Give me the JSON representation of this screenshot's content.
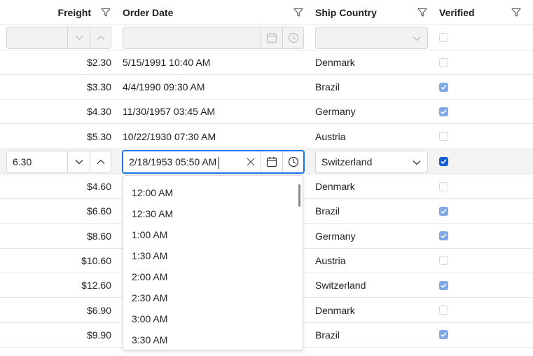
{
  "header": {
    "freight": "Freight",
    "order_date": "Order Date",
    "ship_country": "Ship Country",
    "verified": "Verified"
  },
  "filter_row": {
    "freight_value": "",
    "date_value": "",
    "country_value": ""
  },
  "rows_top": [
    {
      "freight": "$2.30",
      "date": "5/15/1991 10:40 AM",
      "country": "Denmark",
      "verified": false
    },
    {
      "freight": "$3.30",
      "date": "4/4/1990 09:30 AM",
      "country": "Brazil",
      "verified": true
    },
    {
      "freight": "$4.30",
      "date": "11/30/1957 03:45 AM",
      "country": "Germany",
      "verified": true
    },
    {
      "freight": "$5.30",
      "date": "10/22/1930 07:30 AM",
      "country": "Austria",
      "verified": false
    }
  ],
  "edit_row": {
    "freight": "6.30",
    "date": "2/18/1953 05:50 AM",
    "country": "Switzerland",
    "verified": true
  },
  "rows_bottom": [
    {
      "freight": "$4.60",
      "country": "Denmark",
      "verified": false
    },
    {
      "freight": "$6.60",
      "country": "Brazil",
      "verified": true
    },
    {
      "freight": "$8.60",
      "country": "Germany",
      "verified": true
    },
    {
      "freight": "$10.60",
      "country": "Austria",
      "verified": false
    },
    {
      "freight": "$12.60",
      "country": "Switzerland",
      "verified": true
    },
    {
      "freight": "$6.90",
      "country": "Denmark",
      "verified": false
    },
    {
      "freight": "$9.90",
      "country": "Brazil",
      "verified": true
    }
  ],
  "time_options": [
    "12:00 AM",
    "12:30 AM",
    "1:00 AM",
    "1:30 AM",
    "2:00 AM",
    "2:30 AM",
    "3:00 AM",
    "3:30 AM"
  ],
  "colors": {
    "accent": "#1a73e8",
    "check_light": "#7ea8e6",
    "check_strong": "#1560d0"
  }
}
